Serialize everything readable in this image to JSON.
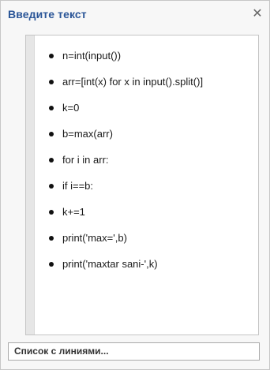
{
  "pane": {
    "title": "Введите текст",
    "close_icon": "close-icon",
    "close_glyph": "✕"
  },
  "items": [
    "n=int(input())",
    "arr=[int(x) for x  in input().split()]",
    "k=0",
    "b=max(arr)",
    "for i in arr:",
    "if i==b:",
    "k+=1",
    "print('max=',b)",
    "print('maxtar sani-',k)"
  ],
  "layout": {
    "label": "Список с линиями..."
  },
  "colors": {
    "title": "#2a5597",
    "bullet": "#111111"
  }
}
